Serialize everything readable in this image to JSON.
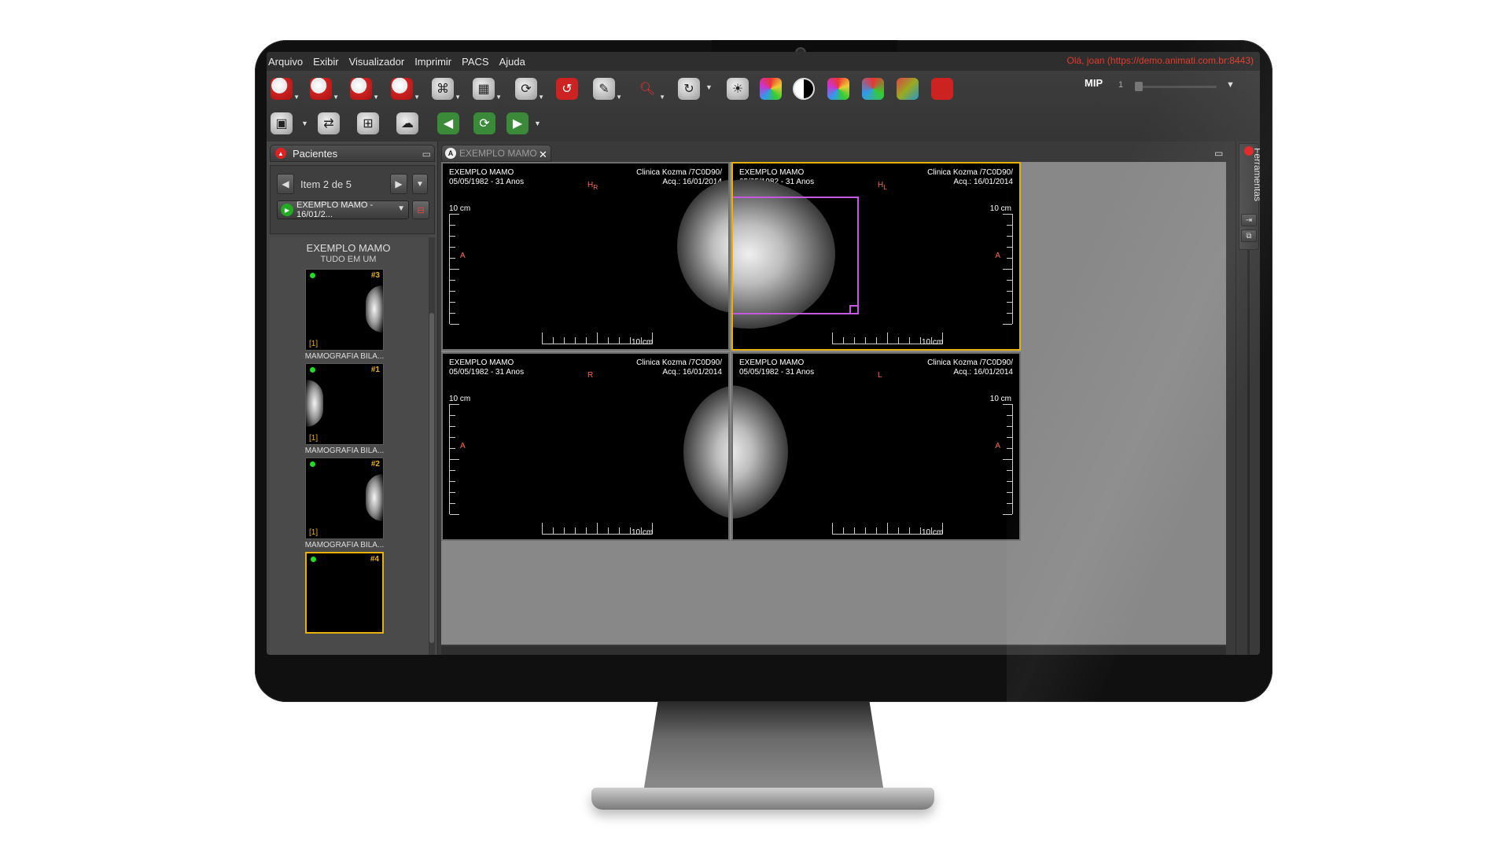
{
  "menu": {
    "items": [
      "Arquivo",
      "Exibir",
      "Visualizador",
      "Imprimir",
      "PACS",
      "Ajuda"
    ],
    "user_info": "Olá, joan (https://demo.animati.com.br:8443)"
  },
  "toolbar": {
    "mip_label": "MIP",
    "mip_value": "1",
    "slider_level": 0.0,
    "row1_icons": [
      "open-study-icon",
      "lock-study-icon",
      "search-study-icon",
      "export-study-icon",
      "network-icon",
      "layout-icon",
      "sync-icon",
      "reset-icon",
      "annotate-icon",
      "zoom-icon",
      "rotate-icon",
      "brightness-icon",
      "color-map-icon",
      "invert-icon",
      "3d-icon",
      "axes-icon",
      "cube-icon",
      "mip-icon"
    ],
    "row2_icons": [
      "capture-icon",
      "compare-icon",
      "grid-icon",
      "cloud-icon",
      "prev-series-icon",
      "refresh-icon",
      "next-series-icon"
    ]
  },
  "patients": {
    "tab_label": "Pacientes",
    "nav_label": "Item 2 de 5",
    "study_select": "EXEMPLO MAMO - 16/01/2...",
    "series_title": "EXEMPLO MAMO",
    "series_subtitle": "TUDO EM UM",
    "thumbnails": [
      {
        "number": "#3",
        "index": "[1]",
        "caption": "MAMOGRAFIA BILA...",
        "selected": false
      },
      {
        "number": "#1",
        "index": "[1]",
        "caption": "MAMOGRAFIA BILA...",
        "selected": false
      },
      {
        "number": "#2",
        "index": "[1]",
        "caption": "MAMOGRAFIA BILA...",
        "selected": false
      },
      {
        "number": "#4",
        "index": "",
        "caption": "",
        "selected": true
      }
    ]
  },
  "viewer": {
    "tab_label": "EXEMPLO MAMO",
    "viewports": [
      {
        "patient": "EXEMPLO MAMO",
        "dob": "05/05/1982 - 31 Anos",
        "institution": "Clinica Kozma /7C0D90/",
        "acq": "Acq.: 16/01/2014",
        "orientation": "H",
        "orientation_sub": "R",
        "side_marker": "A",
        "scale": "10 cm",
        "active": false
      },
      {
        "patient": "EXEMPLO MAMO",
        "dob": "05/05/1982 - 31 Anos",
        "institution": "Clinica Kozma /7C0D90/",
        "acq": "Acq.: 16/01/2014",
        "orientation": "H",
        "orientation_sub": "L",
        "side_marker": "A",
        "scale": "10 cm",
        "active": true
      },
      {
        "patient": "EXEMPLO MAMO",
        "dob": "05/05/1982 - 31 Anos",
        "institution": "Clinica Kozma /7C0D90/",
        "acq": "Acq.: 16/01/2014",
        "orientation": "R",
        "orientation_sub": "",
        "side_marker": "A",
        "scale": "10 cm",
        "active": false
      },
      {
        "patient": "EXEMPLO MAMO",
        "dob": "05/05/1982 - 31 Anos",
        "institution": "Clinica Kozma /7C0D90/",
        "acq": "Acq.: 16/01/2014",
        "orientation": "L",
        "orientation_sub": "",
        "side_marker": "A",
        "scale": "10 cm",
        "active": false
      }
    ]
  },
  "right_rail": {
    "tools_label": "Ferramentas"
  },
  "colors": {
    "accent": "#e8b10a",
    "roi": "#c458e0",
    "user_text": "#e23a2a",
    "orientation_text": "#ff6a4a"
  }
}
